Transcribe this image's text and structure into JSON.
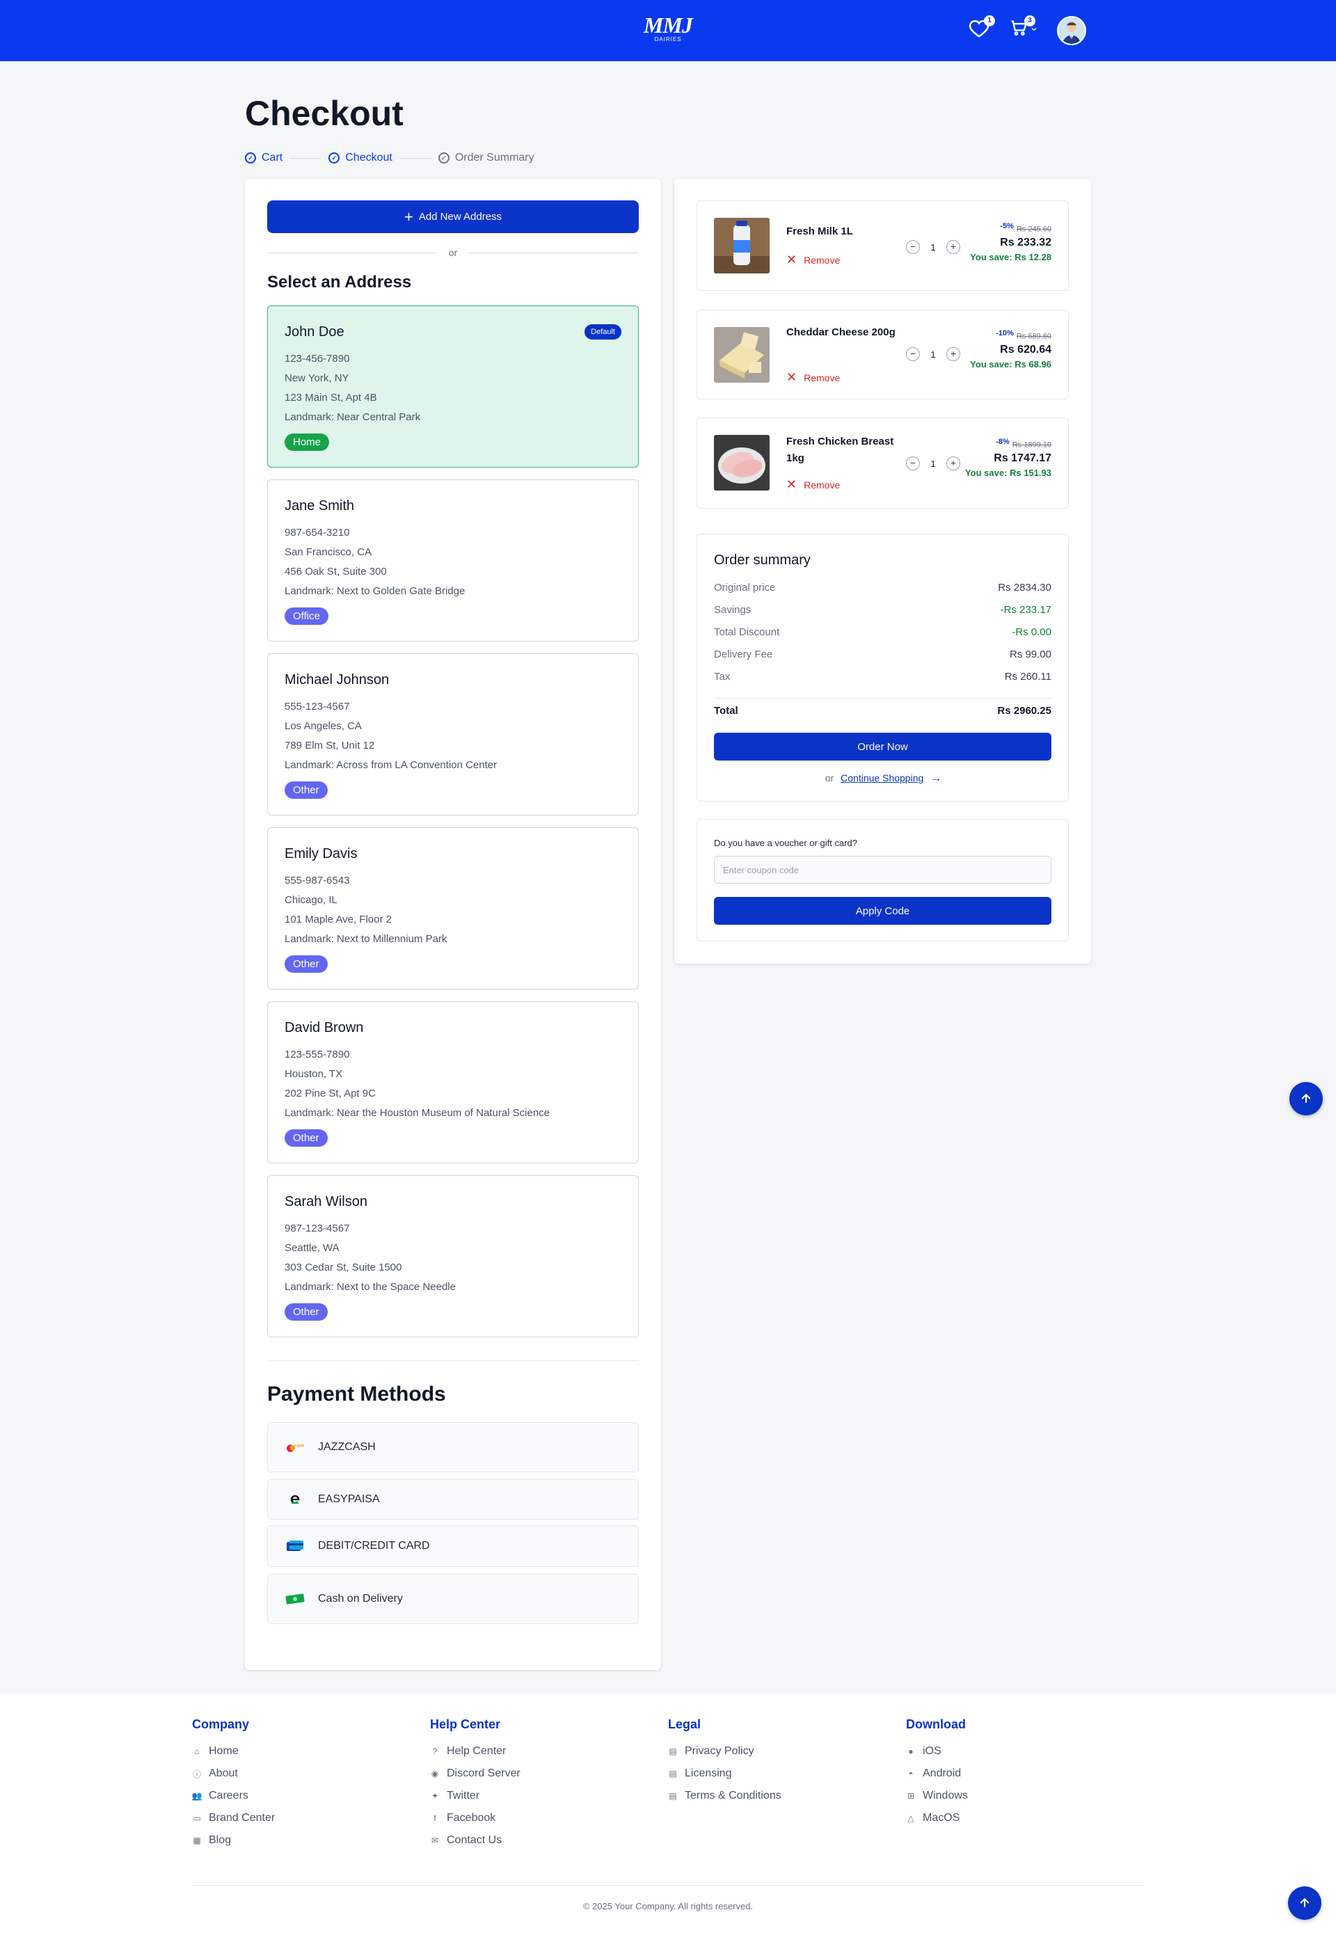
{
  "header": {
    "logo_text": "MMJ",
    "logo_sub": "DAIRIES",
    "wishlist_count": "1",
    "cart_count": "3"
  },
  "page": {
    "title": "Checkout",
    "steps": [
      "Cart",
      "Checkout",
      "Order Summary"
    ]
  },
  "address": {
    "add_button": "Add New Address",
    "or": "or",
    "title": "Select an Address",
    "default_badge": "Default",
    "items": [
      {
        "name": "John Doe",
        "phone": "123-456-7890",
        "city": "New York, NY",
        "street": "123 Main St, Apt 4B",
        "landmark": "Landmark: Near Central Park",
        "tag": "Home"
      },
      {
        "name": "Jane Smith",
        "phone": "987-654-3210",
        "city": "San Francisco, CA",
        "street": "456 Oak St, Suite 300",
        "landmark": "Landmark: Next to Golden Gate Bridge",
        "tag": "Office"
      },
      {
        "name": "Michael Johnson",
        "phone": "555-123-4567",
        "city": "Los Angeles, CA",
        "street": "789 Elm St, Unit 12",
        "landmark": "Landmark: Across from LA Convention Center",
        "tag": "Other"
      },
      {
        "name": "Emily Davis",
        "phone": "555-987-6543",
        "city": "Chicago, IL",
        "street": "101 Maple Ave, Floor 2",
        "landmark": "Landmark: Next to Millennium Park",
        "tag": "Other"
      },
      {
        "name": "David Brown",
        "phone": "123-555-7890",
        "city": "Houston, TX",
        "street": "202 Pine St, Apt 9C",
        "landmark": "Landmark: Near the Houston Museum of Natural Science",
        "tag": "Other"
      },
      {
        "name": "Sarah Wilson",
        "phone": "987-123-4567",
        "city": "Seattle, WA",
        "street": "303 Cedar St, Suite 1500",
        "landmark": "Landmark: Next to the Space Needle",
        "tag": "Other"
      }
    ]
  },
  "payment": {
    "title": "Payment Methods",
    "methods": [
      "JAZZCASH",
      "EASYPAISA",
      "DEBIT/CREDIT CARD",
      "Cash on Delivery"
    ]
  },
  "cart": {
    "remove_label": "Remove",
    "items": [
      {
        "name": "Fresh Milk 1L",
        "qty": "1",
        "discount": "-5%",
        "old_price": "Rs 245.60",
        "price": "Rs 233.32",
        "save": "You save: Rs 12.28"
      },
      {
        "name": "Cheddar Cheese 200g",
        "qty": "1",
        "discount": "-10%",
        "old_price": "Rs 689.60",
        "price": "Rs 620.64",
        "save": "You save: Rs 68.96"
      },
      {
        "name": "Fresh Chicken Breast 1kg",
        "qty": "1",
        "discount": "-8%",
        "old_price": "Rs 1899.10",
        "price": "Rs 1747.17",
        "save": "You save: Rs 151.93"
      }
    ]
  },
  "summary": {
    "title": "Order summary",
    "rows": [
      {
        "label": "Original price",
        "value": "Rs 2834.30"
      },
      {
        "label": "Savings",
        "value": "-Rs 233.17"
      },
      {
        "label": "Total Discount",
        "value": "-Rs 0.00"
      },
      {
        "label": "Delivery Fee",
        "value": "Rs 99.00"
      },
      {
        "label": "Tax",
        "value": "Rs 260.11"
      }
    ],
    "total_label": "Total",
    "total_value": "Rs 2960.25",
    "order_button": "Order Now",
    "or": "or",
    "continue_link": "Continue Shopping"
  },
  "voucher": {
    "question": "Do you have a voucher or gift card?",
    "placeholder": "Enter coupon code",
    "apply_button": "Apply Code"
  },
  "footer": {
    "columns": [
      {
        "title": "Company",
        "links": [
          "Home",
          "About",
          "Careers",
          "Brand Center",
          "Blog"
        ]
      },
      {
        "title": "Help Center",
        "links": [
          "Help Center",
          "Discord Server",
          "Twitter",
          "Facebook",
          "Contact Us"
        ]
      },
      {
        "title": "Legal",
        "links": [
          "Privacy Policy",
          "Licensing",
          "Terms & Conditions"
        ]
      },
      {
        "title": "Download",
        "links": [
          "iOS",
          "Android",
          "Windows",
          "MacOS"
        ]
      }
    ],
    "copyright": "© 2025 Your Company. All rights reserved."
  },
  "colors": {
    "primary": "#0a33c8",
    "header": "#0a3af0",
    "selected_bg": "#dff5ec",
    "success": "#15803d",
    "danger": "#dc2626"
  }
}
